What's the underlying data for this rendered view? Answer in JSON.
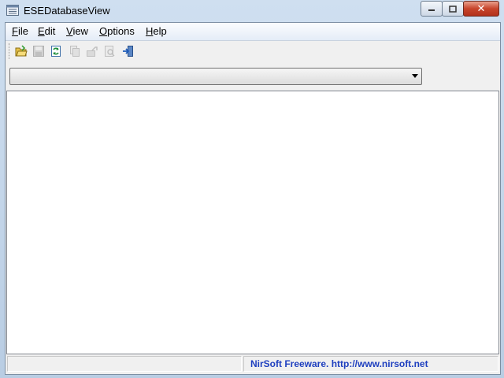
{
  "window": {
    "title": "ESEDatabaseView"
  },
  "menu": [
    {
      "label": "File",
      "key": "F"
    },
    {
      "label": "Edit",
      "key": "E"
    },
    {
      "label": "View",
      "key": "V"
    },
    {
      "label": "Options",
      "key": "O"
    },
    {
      "label": "Help",
      "key": "H"
    }
  ],
  "toolbar": {
    "buttons": [
      {
        "icon": "open-folder-icon",
        "enabled": true
      },
      {
        "icon": "save-icon",
        "enabled": false
      },
      {
        "icon": "refresh-icon",
        "enabled": true
      },
      {
        "icon": "copy-icon",
        "enabled": false
      },
      {
        "icon": "export-icon",
        "enabled": false
      },
      {
        "icon": "properties-icon",
        "enabled": false
      },
      {
        "icon": "exit-icon",
        "enabled": true
      }
    ]
  },
  "table_selector": {
    "value": ""
  },
  "statusbar": {
    "left": "",
    "right": "NirSoft Freeware.  http://www.nirsoft.net"
  }
}
